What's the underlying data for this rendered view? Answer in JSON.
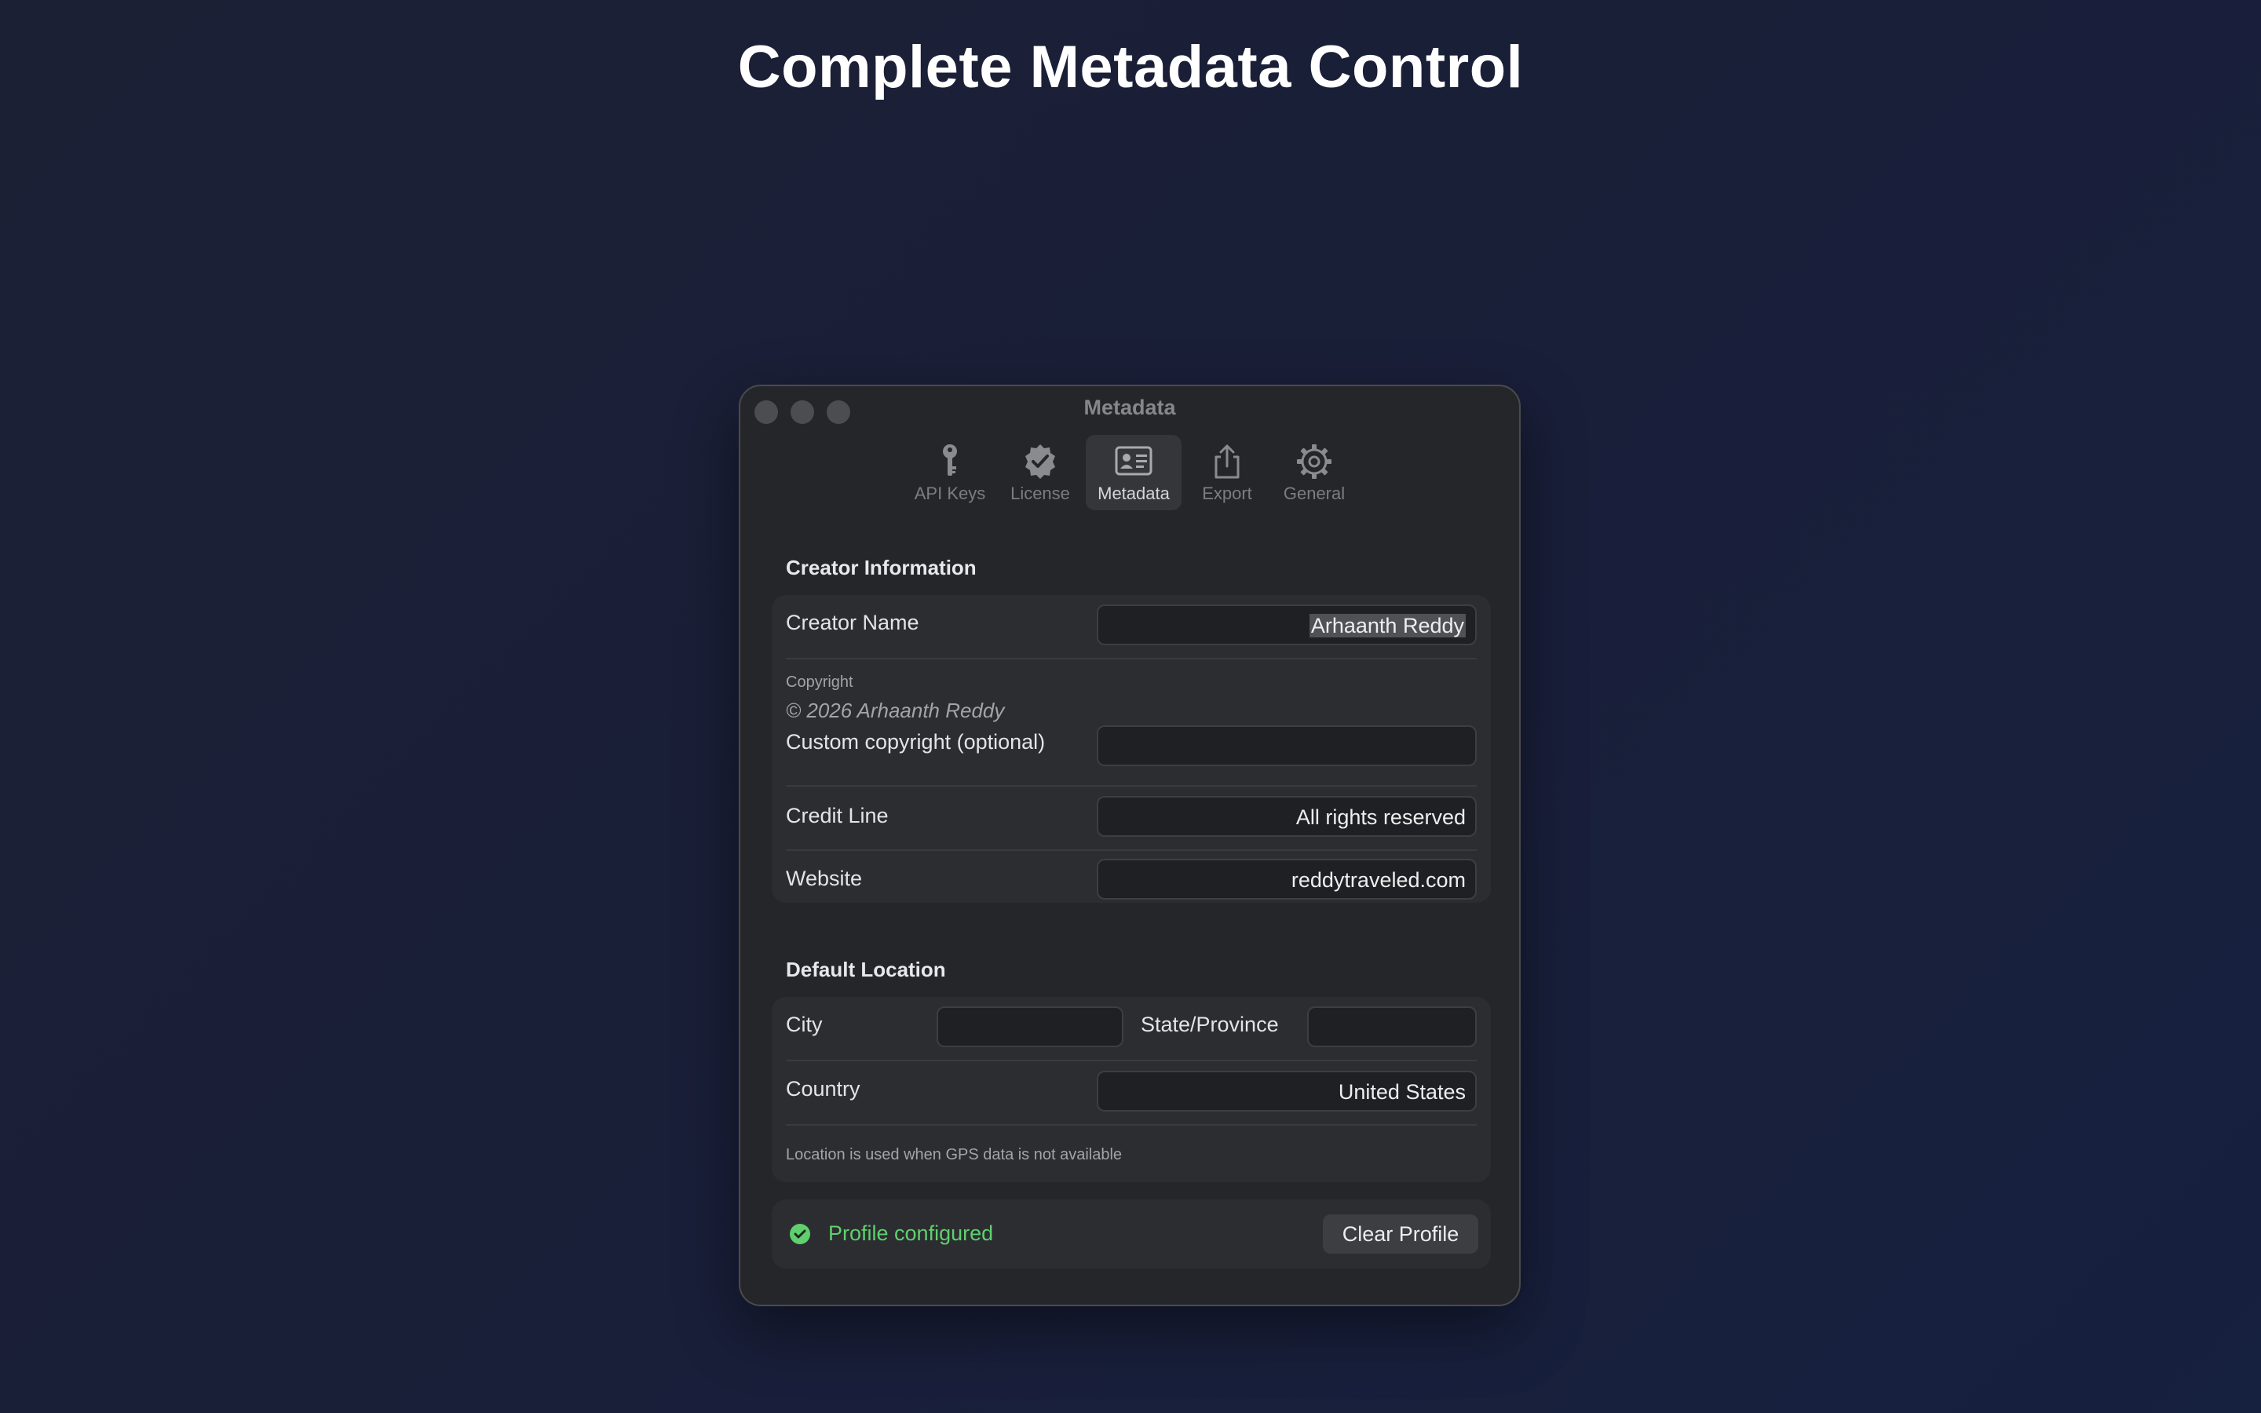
{
  "headline": "Complete Metadata Control",
  "window": {
    "title": "Metadata",
    "tabs": [
      {
        "label": "API Keys",
        "icon": "key-icon"
      },
      {
        "label": "License",
        "icon": "verified-badge-icon"
      },
      {
        "label": "Metadata",
        "icon": "contact-card-icon"
      },
      {
        "label": "Export",
        "icon": "share-icon"
      },
      {
        "label": "General",
        "icon": "gear-icon"
      }
    ],
    "active_tab": "Metadata"
  },
  "creator": {
    "section_title": "Creator Information",
    "creator_name_label": "Creator Name",
    "creator_name_value": "Arhaanth Reddy",
    "copyright_caption": "Copyright",
    "copyright_preview": "© 2026 Arhaanth Reddy",
    "custom_copyright_label": "Custom copyright (optional)",
    "custom_copyright_value": "",
    "credit_line_label": "Credit Line",
    "credit_line_value": "All rights reserved",
    "website_label": "Website",
    "website_value": "reddytraveled.com"
  },
  "location": {
    "section_title": "Default Location",
    "city_label": "City",
    "city_value": "",
    "state_label": "State/Province",
    "state_value": "",
    "country_label": "Country",
    "country_value": "United States",
    "note": "Location is used when GPS data is not available"
  },
  "status": {
    "text": "Profile configured",
    "color": "#5fd06e",
    "clear_button": "Clear Profile"
  },
  "colors": {
    "background": "#1b2038",
    "window": "#252629",
    "group": "#2c2d31",
    "status_green": "#5fd06e"
  }
}
